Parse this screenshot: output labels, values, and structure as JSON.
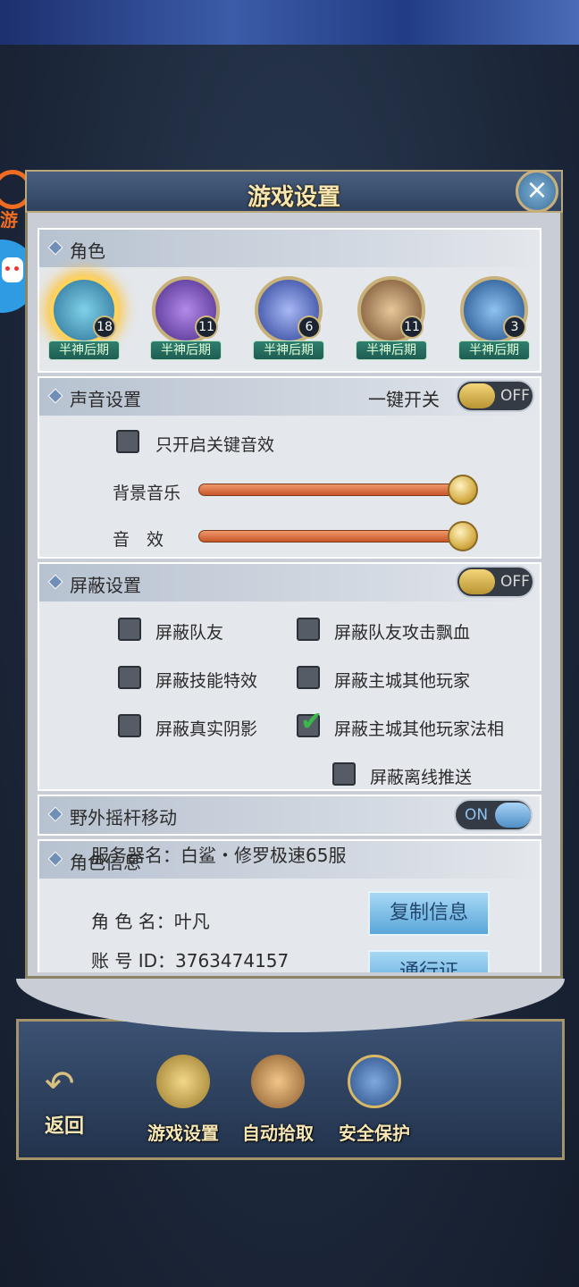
{
  "window": {
    "title": "游戏设置",
    "close_icon": "×"
  },
  "side": {
    "logo_text": "游"
  },
  "role_section": {
    "title": "角色",
    "heroes": [
      {
        "level": "18",
        "stage": "半神后期",
        "active": true,
        "color": "#3b8fb8"
      },
      {
        "level": "11",
        "stage": "半神后期",
        "active": false,
        "color": "#6a3fb5"
      },
      {
        "level": "6",
        "stage": "半神后期",
        "active": false,
        "color": "#4a67c7"
      },
      {
        "level": "11",
        "stage": "半神后期",
        "active": false,
        "color": "#a27a4a"
      },
      {
        "level": "3",
        "stage": "半神后期",
        "active": false,
        "color": "#2d6fb0"
      }
    ]
  },
  "sound_section": {
    "title": "声音设置",
    "master_label": "一键开关",
    "master_toggle": "OFF",
    "key_only_label": "只开启关键音效",
    "bgm_label": "背景音乐",
    "bgm_level": 1.0,
    "sfx_label": "音　效",
    "sfx_level": 1.0
  },
  "block_section": {
    "title": "屏蔽设置",
    "toggle": "OFF",
    "options": [
      {
        "label": "屏蔽队友",
        "checked": false
      },
      {
        "label": "屏蔽队友攻击飘血",
        "checked": false
      },
      {
        "label": "屏蔽技能特效",
        "checked": false
      },
      {
        "label": "屏蔽主城其他玩家",
        "checked": false
      },
      {
        "label": "屏蔽真实阴影",
        "checked": false
      },
      {
        "label": "屏蔽主城其他玩家法相",
        "checked": true
      },
      {
        "label": "屏蔽离线推送",
        "checked": false
      }
    ]
  },
  "joystick_section": {
    "title": "野外摇杆移动",
    "toggle": "ON"
  },
  "info_section": {
    "title": "角色信息",
    "server": "服务器名：白鲨・修罗极速65服",
    "role_name": "角 色 名：叶凡",
    "account_id": "账 号 ID：3763474157",
    "copy_button": "复制信息",
    "pass_button": "通行证"
  },
  "bottom_nav": {
    "back": "返回",
    "items": [
      {
        "label": "游戏设置",
        "icon": "gear-icon"
      },
      {
        "label": "自动拾取",
        "icon": "money-bag-icon"
      },
      {
        "label": "安全保护",
        "icon": "shield-lock-icon"
      }
    ]
  }
}
